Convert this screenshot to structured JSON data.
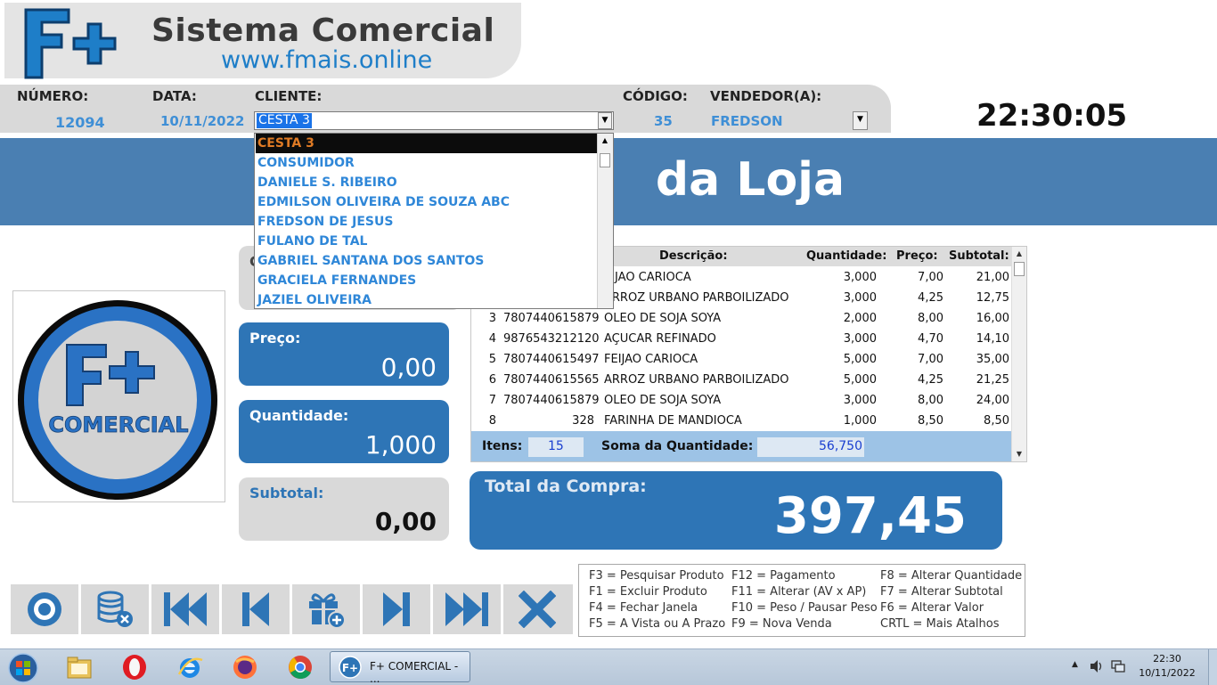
{
  "app": {
    "title": "Sistema Comercial",
    "url": "www.fmais.online"
  },
  "header": {
    "numero_label": "NÚMERO:",
    "numero_value": "12094",
    "data_label": "DATA:",
    "data_value": "10/11/2022",
    "cliente_label": "CLIENTE:",
    "cliente_value": "CESTA 3",
    "codigo_label": "CÓDIGO:",
    "codigo_value": "35",
    "vendedor_label": "VENDEDOR(A):",
    "vendedor_value": "FREDSON"
  },
  "clock": "22:30:05",
  "banner": {
    "visible_text": "da Loja"
  },
  "client_dropdown": {
    "items": [
      "CESTA 3",
      "CONSUMIDOR",
      "DANIELE S. RIBEIRO",
      "EDMILSON OLIVEIRA DE SOUZA ABC",
      "FREDSON DE JESUS",
      "FULANO DE TAL",
      "GABRIEL SANTANA DOS SANTOS",
      "GRACIELA FERNANDES",
      "JAZIEL OLIVEIRA"
    ],
    "selected_index": 0
  },
  "logo_panel": {
    "brand": "F+",
    "caption": "COMERCIAL"
  },
  "panels": {
    "code_label_partial": "C",
    "price_label": "Preço:",
    "price_value": "0,00",
    "qty_label": "Quantidade:",
    "qty_value": "1,000",
    "subtotal_label": "Subtotal:",
    "subtotal_value": "0,00"
  },
  "table": {
    "headers": [
      "Descrição:",
      "Quantidade:",
      "Preço:",
      "Subtotal:"
    ],
    "rows": [
      {
        "n": "",
        "code": "",
        "desc": "EIJAO CARIOCA",
        "qty": "3,000",
        "price": "7,00",
        "subtotal": "21,00"
      },
      {
        "n": "",
        "code": "",
        "desc": "ARROZ URBANO PARBOILIZADO",
        "qty": "3,000",
        "price": "4,25",
        "subtotal": "12,75"
      },
      {
        "n": "3",
        "code": "7807440615879",
        "desc": "OLEO DE SOJA SOYA",
        "qty": "2,000",
        "price": "8,00",
        "subtotal": "16,00"
      },
      {
        "n": "4",
        "code": "9876543212120",
        "desc": "AÇUCAR REFINADO",
        "qty": "3,000",
        "price": "4,70",
        "subtotal": "14,10"
      },
      {
        "n": "5",
        "code": "7807440615497",
        "desc": "FEIJAO CARIOCA",
        "qty": "5,000",
        "price": "7,00",
        "subtotal": "35,00"
      },
      {
        "n": "6",
        "code": "7807440615565",
        "desc": "ARROZ URBANO PARBOILIZADO",
        "qty": "5,000",
        "price": "4,25",
        "subtotal": "21,25"
      },
      {
        "n": "7",
        "code": "7807440615879",
        "desc": "OLEO DE SOJA SOYA",
        "qty": "3,000",
        "price": "8,00",
        "subtotal": "24,00"
      },
      {
        "n": "8",
        "code": "328",
        "desc": "FARINHA DE MANDIOCA",
        "qty": "1,000",
        "price": "8,50",
        "subtotal": "8,50"
      }
    ],
    "footer": {
      "itens_label": "Itens:",
      "itens_value": "15",
      "soma_label": "Soma da Quantidade:",
      "soma_value": "56,750"
    }
  },
  "total": {
    "label": "Total da Compra:",
    "value": "397,45"
  },
  "shortcuts": {
    "col1": [
      "F3 = Pesquisar Produto",
      "F1 = Excluir Produto",
      "F4 = Fechar Janela",
      "F5 = A Vista ou A Prazo"
    ],
    "col2": [
      "F12 = Pagamento",
      "F11 = Alterar (AV x AP)",
      "F10 = Peso / Pausar Peso",
      "F9 = Nova Venda"
    ],
    "col3": [
      "F8 = Alterar Quantidade",
      "F7 = Alterar Subtotal",
      "F6 = Alterar Valor",
      "CRTL = Mais Atalhos"
    ]
  },
  "toolbar": {
    "icons": [
      "record-icon",
      "database-delete-icon",
      "first-icon",
      "previous-icon",
      "gift-add-icon",
      "next-icon",
      "last-icon",
      "close-icon"
    ]
  },
  "taskbar": {
    "app_label": "F+ COMERCIAL - ...",
    "time": "22:30",
    "date": "10/11/2022"
  },
  "colors": {
    "accent_blue": "#2e75b6",
    "banner_blue": "#4a7fb2",
    "text_blue": "#3f8fd6",
    "selected_orange": "#e07b25"
  }
}
